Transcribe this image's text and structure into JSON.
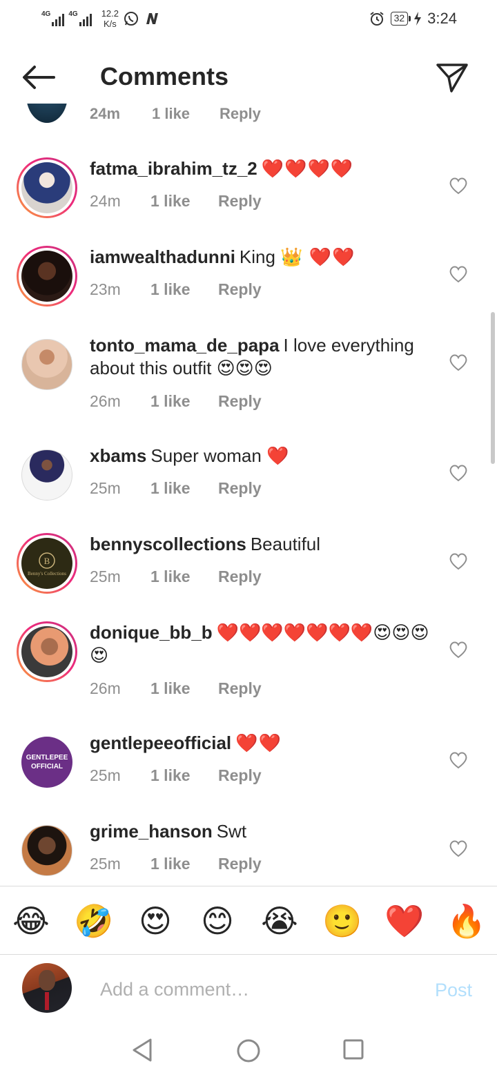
{
  "status_bar": {
    "network1": "4G",
    "network2": "4G",
    "speed_value": "12.2",
    "speed_unit": "K/s",
    "battery": "32",
    "time": "3:24"
  },
  "header": {
    "title": "Comments"
  },
  "partial_row": {
    "time": "24m",
    "likes": "1 like",
    "reply": "Reply"
  },
  "comments": [
    {
      "username": "fatma_ibrahim_tz_2",
      "text": "",
      "emoji": "❤️❤️❤️❤️",
      "time": "24m",
      "likes": "1 like",
      "reply": "Reply"
    },
    {
      "username": "iamwealthadunni",
      "text": "King ",
      "emoji": "👑 ❤️❤️",
      "time": "23m",
      "likes": "1 like",
      "reply": "Reply"
    },
    {
      "username": "tonto_mama_de_papa",
      "text": "I love everything about this outfit ",
      "emoji": "😍😍😍",
      "time": "26m",
      "likes": "1 like",
      "reply": "Reply"
    },
    {
      "username": "xbams",
      "text": "Super woman ",
      "emoji": "❤️",
      "time": "25m",
      "likes": "1 like",
      "reply": "Reply"
    },
    {
      "username": "bennyscollections",
      "text": "Beautiful",
      "emoji": "",
      "time": "25m",
      "likes": "1 like",
      "reply": "Reply"
    },
    {
      "username": "donique_bb_b",
      "text": "",
      "emoji": "❤️❤️❤️❤️❤️❤️❤️😍😍😍😍",
      "time": "26m",
      "likes": "1 like",
      "reply": "Reply"
    },
    {
      "username": "gentlepeeofficial",
      "text": "",
      "emoji": "❤️❤️",
      "time": "25m",
      "likes": "1 like",
      "reply": "Reply"
    },
    {
      "username": "grime_hanson",
      "text": "Swt",
      "emoji": "",
      "time": "25m",
      "likes": "1 like",
      "reply": "Reply"
    }
  ],
  "avatar_badges": {
    "benny_logo_text": "Benny's Collections",
    "gentlepee_line1": "GENTLEPEE",
    "gentlepee_line2": "OFFICIAL"
  },
  "emoji_bar": [
    "😂",
    "🤣",
    "😍",
    "😊",
    "😭",
    "🙂",
    "❤️",
    "🔥"
  ],
  "composer": {
    "placeholder": "Add a comment…",
    "post_label": "Post"
  },
  "colors": {
    "story_ring_start": "#f9a13b",
    "story_ring_end": "#c8327f",
    "post_disabled": "#b2dffc",
    "meta_gray": "#8e8e8e"
  }
}
